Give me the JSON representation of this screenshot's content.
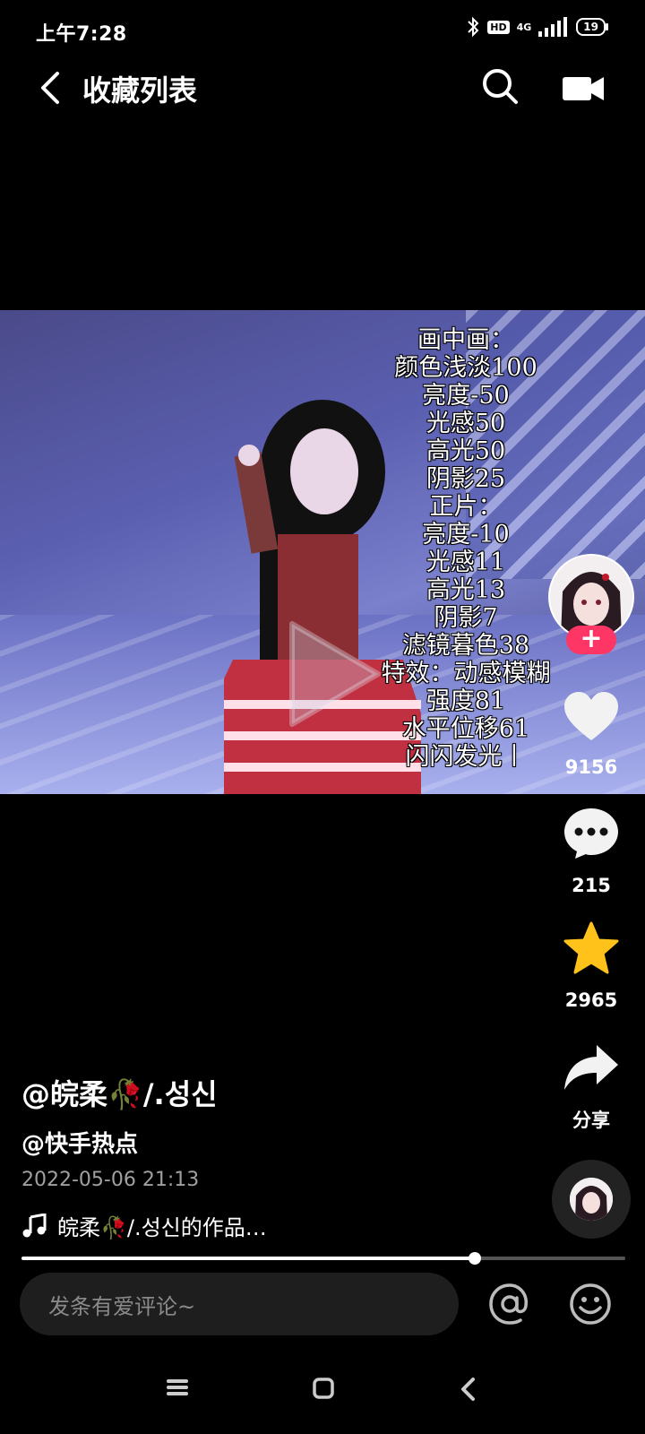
{
  "status_bar": {
    "time": "上午7:28",
    "hd_label": "HD",
    "network_label": "4G",
    "battery_level": "19"
  },
  "header": {
    "title": "收藏列表",
    "icons": [
      "back-icon",
      "search-icon",
      "camera-icon"
    ]
  },
  "video": {
    "overlay_lines": [
      "画中画：",
      "颜色浅淡100",
      "亮度-50",
      "光感50",
      "高光50",
      "阴影25",
      "正片：",
      "亮度-10",
      "光感11",
      "高光13",
      "阴影7",
      "滤镜暮色38",
      "特效：动感模糊",
      "强度81",
      "水平位移61",
      "闪闪发光丨"
    ]
  },
  "rail": {
    "follow_label": "+",
    "like_count": "9156",
    "comment_count": "215",
    "favorite_count": "2965",
    "share_label": "分享",
    "colors": {
      "follow": "#fe3666",
      "favorite": "#ffc21a"
    }
  },
  "info": {
    "author": "@皖柔🥀/.성신",
    "topic": "@快手热点",
    "date": "2022-05-06 21:13",
    "music": "皖柔🥀/.성신的作品…"
  },
  "progress": {
    "fraction": 0.75
  },
  "comment": {
    "placeholder": "发条有爱评论~"
  }
}
